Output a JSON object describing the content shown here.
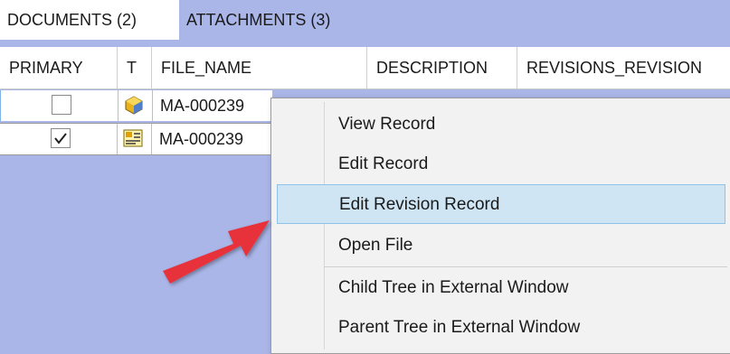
{
  "tabs": {
    "documents": "DOCUMENTS (2)",
    "attachments": "ATTACHMENTS (3)"
  },
  "grid": {
    "columns": [
      "PRIMARY",
      "T",
      "FILE_NAME",
      "DESCRIPTION",
      "REVISIONS_REVISION"
    ],
    "rows": [
      {
        "primary": false,
        "type_icon": "3d-part-icon",
        "file_name": "MA-000239"
      },
      {
        "primary": true,
        "type_icon": "drawing-icon",
        "file_name": "MA-000239"
      }
    ]
  },
  "context_menu": {
    "items": [
      "View Record",
      "Edit Record",
      "Edit Revision Record",
      "Open File",
      "Child Tree in External Window",
      "Parent Tree in External Window"
    ],
    "highlighted_index": 2
  },
  "colors": {
    "background": "#aab6e8",
    "highlight": "#cfe5f4",
    "arrow": "#e8333a"
  }
}
